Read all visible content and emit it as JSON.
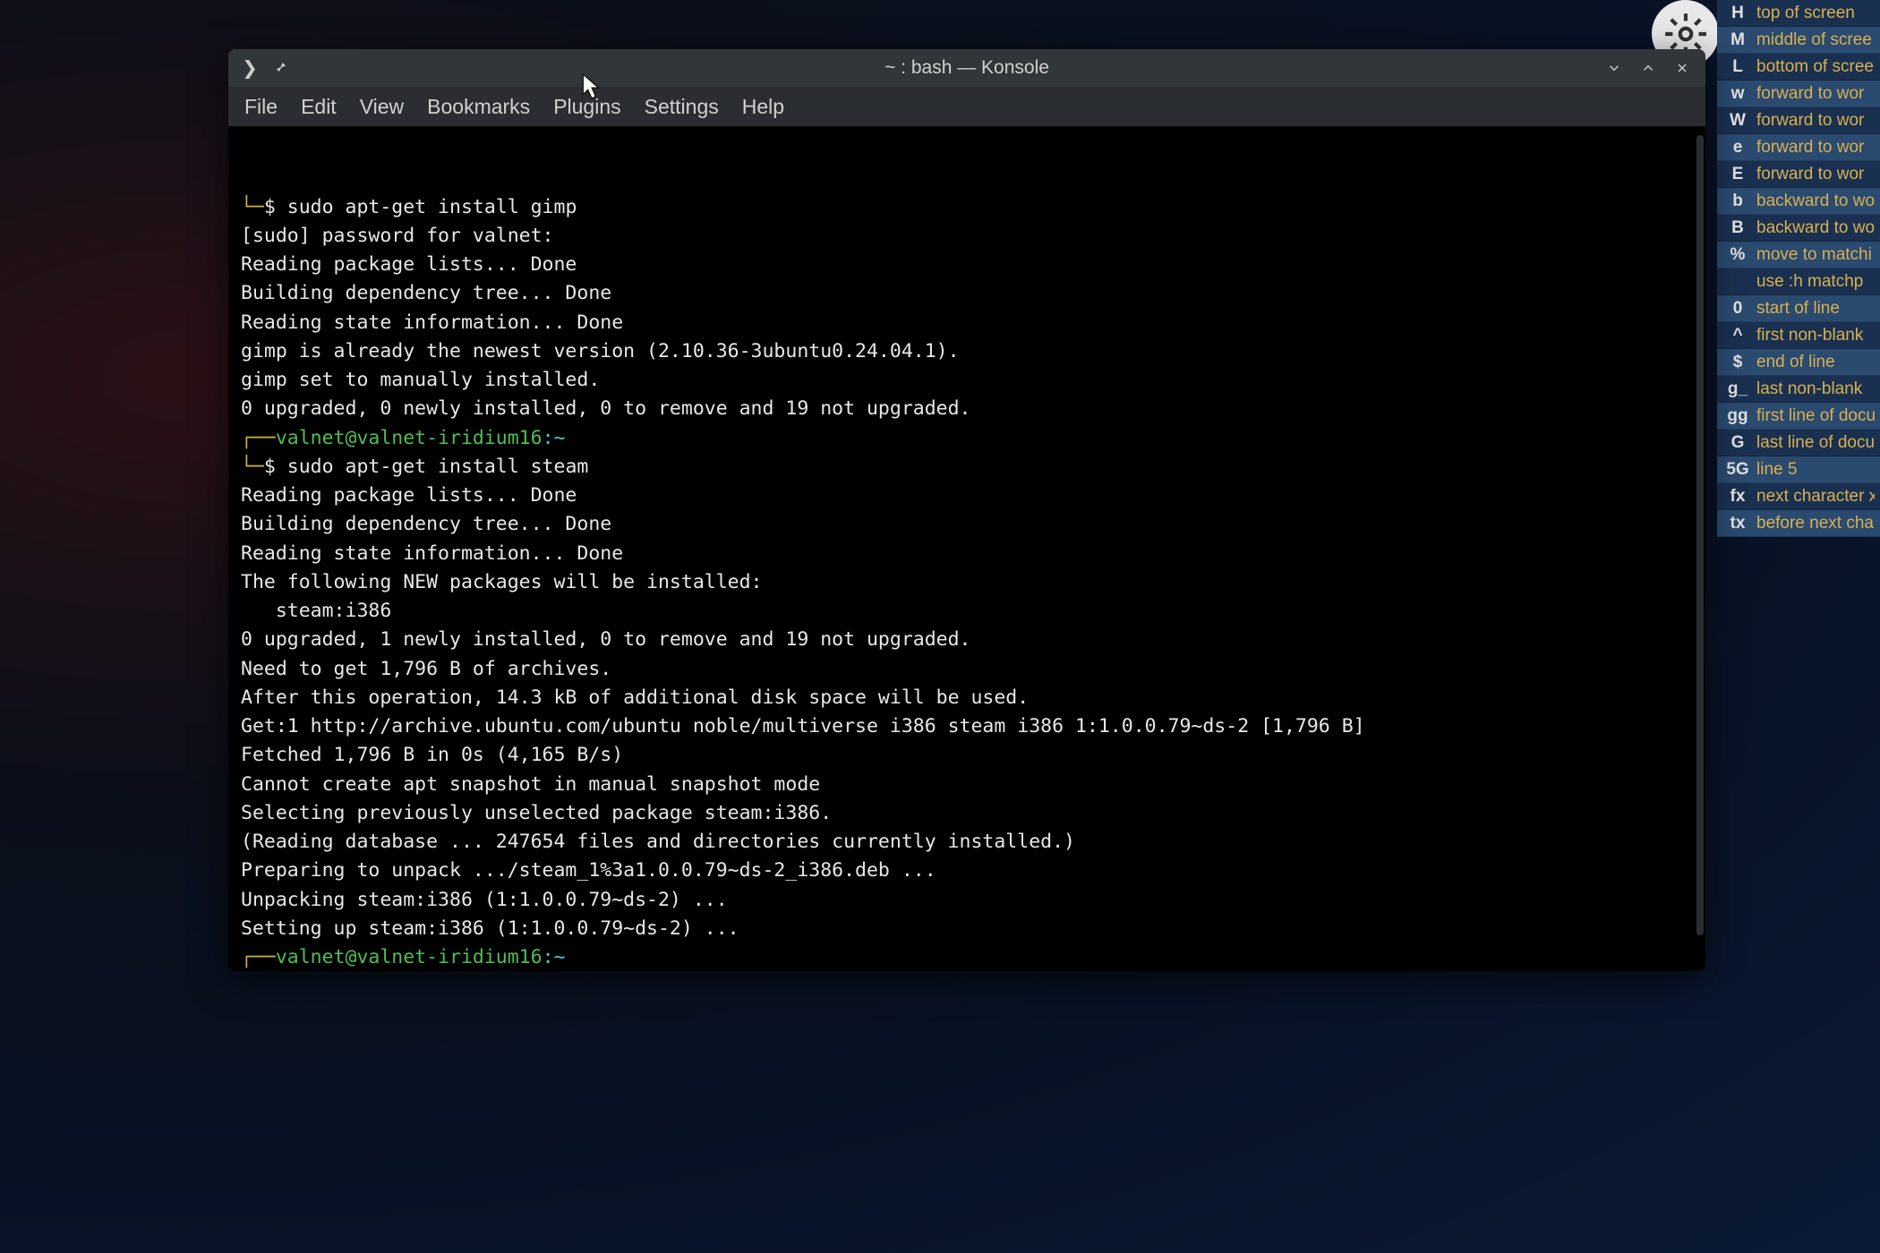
{
  "window": {
    "title": "~ : bash — Konsole"
  },
  "menu": {
    "file": "File",
    "edit": "Edit",
    "view": "View",
    "bookmarks": "Bookmarks",
    "plugins": "Plugins",
    "settings": "Settings",
    "help": "Help"
  },
  "prompt": {
    "user_host": "valnet@valnet-iridium16",
    "path": "~",
    "cmd1": "sudo apt-get install gimp",
    "cmd2": "sudo apt-get install steam"
  },
  "out": {
    "l1": "[sudo] password for valnet:",
    "l2": "Reading package lists... Done",
    "l3": "Building dependency tree... Done",
    "l4": "Reading state information... Done",
    "l5": "gimp is already the newest version (2.10.36-3ubuntu0.24.04.1).",
    "l6": "gimp set to manually installed.",
    "l7": "0 upgraded, 0 newly installed, 0 to remove and 19 not upgraded.",
    "l8": "Reading package lists... Done",
    "l9": "Building dependency tree... Done",
    "l10": "Reading state information... Done",
    "l11": "The following NEW packages will be installed:",
    "l12": "   steam:i386",
    "l13": "0 upgraded, 1 newly installed, 0 to remove and 19 not upgraded.",
    "l14": "Need to get 1,796 B of archives.",
    "l15": "After this operation, 14.3 kB of additional disk space will be used.",
    "l16": "Get:1 http://archive.ubuntu.com/ubuntu noble/multiverse i386 steam i386 1:1.0.0.79~ds-2 [1,796 B]",
    "l17": "Fetched 1,796 B in 0s (4,165 B/s)",
    "l18": "Cannot create apt snapshot in manual snapshot mode",
    "l19": "Selecting previously unselected package steam:i386.",
    "l20": "(Reading database ... 247654 files and directories currently installed.)",
    "l21": "Preparing to unpack .../steam_1%3a1.0.0.79~ds-2_i386.deb ...",
    "l22": "Unpacking steam:i386 (1:1.0.0.79~ds-2) ...",
    "l23": "Setting up steam:i386 (1:1.0.0.79~ds-2) ..."
  },
  "cheat": [
    {
      "k": "H",
      "d": "top of screen",
      "alt": false
    },
    {
      "k": "M",
      "d": "middle of scree",
      "alt": true
    },
    {
      "k": "L",
      "d": "bottom of scree",
      "alt": false
    },
    {
      "k": "w",
      "d": "forward to wor",
      "alt": true
    },
    {
      "k": "W",
      "d": "forward to wor",
      "alt": false
    },
    {
      "k": "e",
      "d": "forward to wor",
      "alt": true
    },
    {
      "k": "E",
      "d": "forward to wor",
      "alt": false
    },
    {
      "k": "b",
      "d": "backward to wo",
      "alt": true
    },
    {
      "k": "B",
      "d": "backward to wo",
      "alt": false
    },
    {
      "k": "%",
      "d": "move to matchi",
      "alt": true
    },
    {
      "k": "",
      "d": "use :h matchp",
      "alt": false
    },
    {
      "k": "0",
      "d": "start of line",
      "alt": true
    },
    {
      "k": "^",
      "d": "first non-blank",
      "alt": false
    },
    {
      "k": "$",
      "d": "end of line",
      "alt": true
    },
    {
      "k": "g_",
      "d": "last non-blank",
      "alt": false
    },
    {
      "k": "gg",
      "d": "first line of docu",
      "alt": true
    },
    {
      "k": "G",
      "d": "last line of docu",
      "alt": false
    },
    {
      "k": "5G",
      "d": "line 5",
      "alt": true
    },
    {
      "k": "fx",
      "d": "next character x",
      "alt": false
    },
    {
      "k": "tx",
      "d": "before next char",
      "alt": true
    }
  ]
}
